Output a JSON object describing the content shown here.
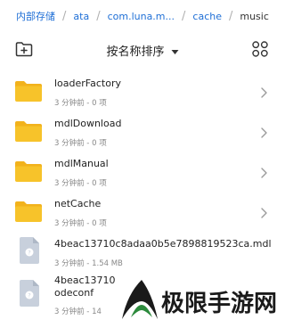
{
  "breadcrumb": {
    "items": [
      "内部存储",
      "ata",
      "com.luna.m...",
      "cache",
      "music"
    ]
  },
  "toolbar": {
    "sort_label": "按名称排序",
    "new_folder_icon": "new-folder-icon",
    "view_icon": "grid-view-icon",
    "sort_icon": "caret-down-icon"
  },
  "files": [
    {
      "name": "loaderFactory",
      "meta": "3 分钟前 - 0 项",
      "type": "folder",
      "icon": "folder-icon"
    },
    {
      "name": "mdlDownload",
      "meta": "3 分钟前 - 0 项",
      "type": "folder",
      "icon": "folder-icon"
    },
    {
      "name": "mdlManual",
      "meta": "3 分钟前 - 0 项",
      "type": "folder",
      "icon": "folder-icon"
    },
    {
      "name": "netCache",
      "meta": "3 分钟前 - 0 项",
      "type": "folder",
      "icon": "folder-icon"
    },
    {
      "name": "4beac13710c8adaa0b5e7898819523ca.mdl",
      "meta": "3 分钟前 - 1.54 MB",
      "type": "file",
      "icon": "unknown-file-icon"
    },
    {
      "name": "4beac13710",
      "name2": "odeconf",
      "meta": "3 分钟前 - 14",
      "type": "file",
      "icon": "unknown-file-icon"
    }
  ],
  "watermark": {
    "text": "极限手游网"
  },
  "colors": {
    "accent": "#1f6fd6",
    "folder": "#f7c32a",
    "folder_tab": "#f2b21c",
    "file_icon": "#c8d0dc",
    "watermark_green": "#2c8a3c",
    "watermark_dark": "#1a1a1a"
  }
}
